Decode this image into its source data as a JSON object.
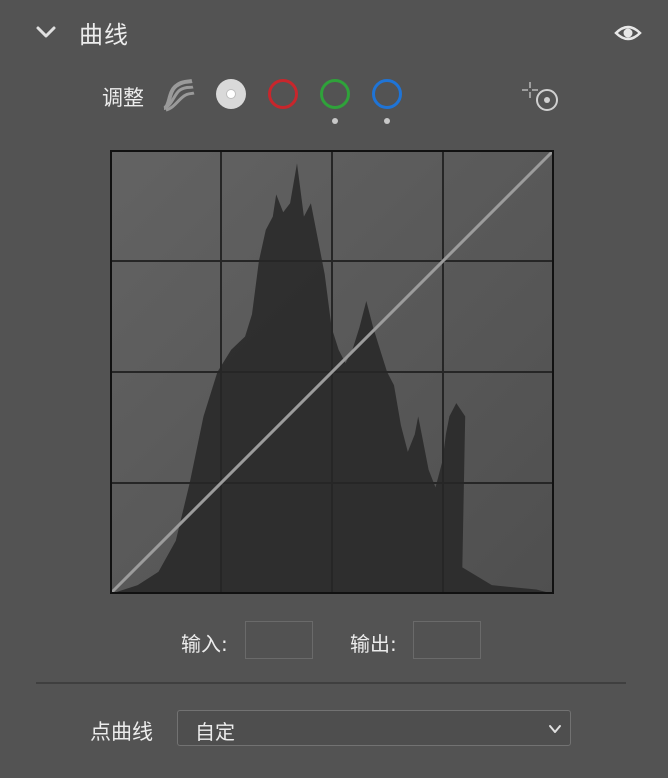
{
  "panel": {
    "title": "曲线",
    "collapse_icon": "chevron-down-icon",
    "visibility_icon": "eye-icon"
  },
  "adjust": {
    "label": "调整",
    "mode_icon": "parametric-curve-icon",
    "channels": [
      {
        "name": "rgb",
        "color": "#d9d9d9",
        "selected": true
      },
      {
        "name": "red",
        "color": "#c8262c",
        "selected": false
      },
      {
        "name": "green",
        "color": "#2fa23a",
        "selected": false
      },
      {
        "name": "blue",
        "color": "#1f74d6",
        "selected": false
      }
    ],
    "target_icon": "targeted-adjustment-icon"
  },
  "graph": {
    "background": "#5a5a5a",
    "histogram_color": "#2e2e2e",
    "curve_color": "#9a9a9a",
    "curve_points": [
      [
        0,
        0
      ],
      [
        255,
        255
      ]
    ]
  },
  "io": {
    "input_label": "输入:",
    "output_label": "输出:",
    "input_value": "",
    "output_value": ""
  },
  "preset": {
    "label": "点曲线",
    "value": "自定"
  }
}
